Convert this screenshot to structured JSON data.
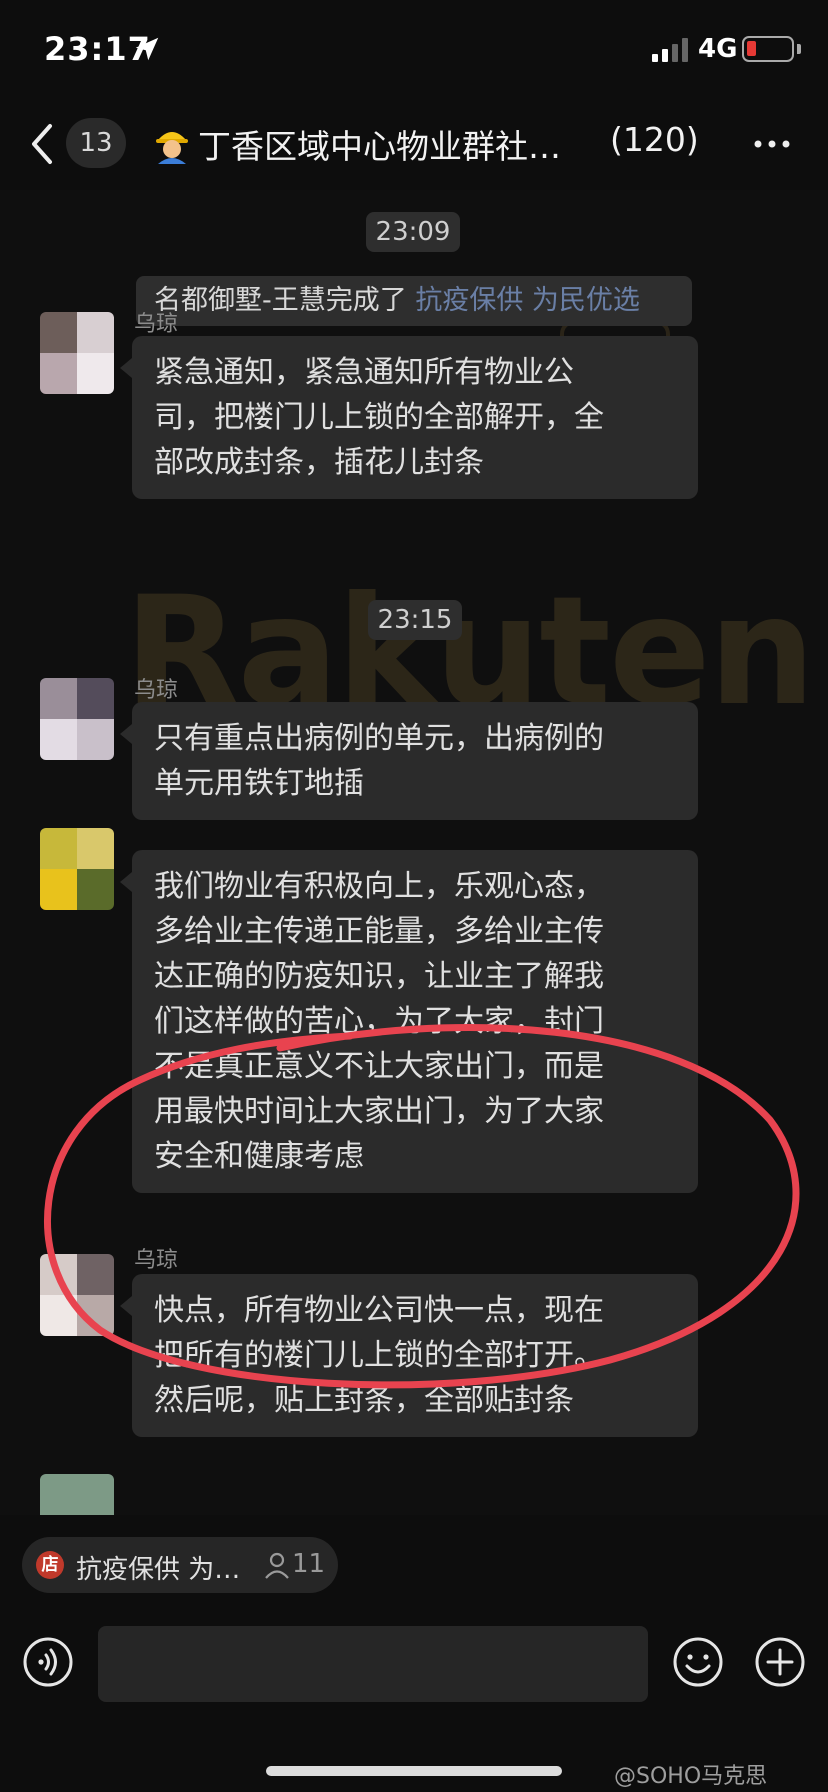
{
  "status_bar": {
    "time": "23:17",
    "network": "4G"
  },
  "nav": {
    "unread_count": "13",
    "title": "丁香区域中心物业群社…",
    "member_count": "(120)"
  },
  "chat": {
    "watermark_text": "Rakuten",
    "time_1": "23:09",
    "system_note": {
      "plain": "名都御墅-王慧完成了 ",
      "link": "抗疫保供 为民优选"
    },
    "time_2": "23:15",
    "messages": [
      {
        "sender": "乌琼",
        "lines": [
          "紧急通知，紧急通知所有物业公",
          "司，把楼门儿上锁的全部解开，全",
          "部改成封条，插花儿封条"
        ]
      },
      {
        "sender": "乌琼",
        "lines": [
          "只有重点出病例的单元，出病例的",
          "单元用铁钉地插"
        ]
      },
      {
        "sender": "",
        "lines": [
          "我们物业有积极向上，乐观心态，",
          "多给业主传递正能量，多给业主传",
          "达正确的防疫知识，让业主了解我",
          "们这样做的苦心，为了大家，封门",
          "不是真正意义不让大家出门，而是",
          "用最快时间让大家出门，为了大家",
          "安全和健康考虑"
        ]
      },
      {
        "sender": "乌琼",
        "lines": [
          "快点，所有物业公司快一点，现在",
          "把所有的楼门儿上锁的全部打开。",
          "然后呢，贴上封条，全部贴封条"
        ]
      }
    ]
  },
  "promo": {
    "shop_icon_label": "店",
    "text": "抗疫保供 为…",
    "count": "11"
  },
  "input": {
    "placeholder": ""
  },
  "footer": {
    "watermark": "@SOHO马克思"
  },
  "colors": {
    "annotation_circle": "#e8434f",
    "bubble": "#2b2b2b",
    "link": "#6a7fa6"
  }
}
